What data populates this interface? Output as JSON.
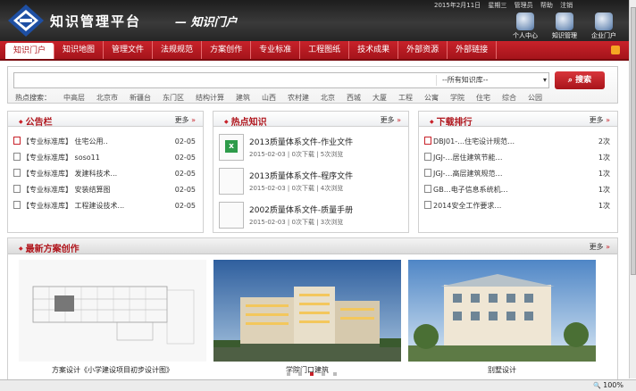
{
  "header": {
    "title": "知识管理平台",
    "subtitle": "— 知识门户",
    "topline": [
      "2015年2月11日",
      "星期三",
      "管理员",
      "帮助",
      "注销"
    ],
    "icons": [
      {
        "label": "个人中心",
        "icon": "person-icon"
      },
      {
        "label": "知识管理",
        "icon": "knowledge-icon"
      },
      {
        "label": "企业门户",
        "icon": "portal-icon"
      }
    ]
  },
  "nav": {
    "items": [
      "知识门户",
      "知识地图",
      "管理文件",
      "法规规范",
      "方案创作",
      "专业标准",
      "工程图纸",
      "技术成果",
      "外部资源",
      "外部链接"
    ]
  },
  "search": {
    "placeholder": "",
    "select_value": "--所有知识库--",
    "button": "搜索",
    "hot_label": "热点搜索：",
    "hot_words": [
      "中高层",
      "北京市",
      "新疆台",
      "东门区",
      "结构计算",
      "建筑",
      "山西",
      "农村建",
      "北京",
      "西城",
      "大厦",
      "工程",
      "公寓",
      "学院",
      "住宅",
      "综合",
      "公园"
    ]
  },
  "notice": {
    "title": "公告栏",
    "more": "更多",
    "rows": [
      {
        "text": "【专业标准库】 住宅公用..",
        "date": "02-05"
      },
      {
        "text": "【专业标准库】 soso11",
        "date": "02-05"
      },
      {
        "text": "【专业标准库】 发建科技术...",
        "date": "02-05"
      },
      {
        "text": "【专业标准库】 安装结算图",
        "date": "02-05"
      },
      {
        "text": "【专业标准库】 工程建设技术...",
        "date": "02-05"
      }
    ]
  },
  "hot": {
    "title": "热点知识",
    "more": "更多",
    "items": [
      {
        "title": "2013质量体系文件-作业文件",
        "meta": "2015-02-03 | 0次下载 | 5次浏览"
      },
      {
        "title": "2013质量体系文件-程序文件",
        "meta": "2015-02-03 | 0次下载 | 4次浏览"
      },
      {
        "title": "2002质量体系文件-质量手册",
        "meta": "2015-02-03 | 0次下载 | 3次浏览"
      }
    ]
  },
  "download": {
    "title": "下载排行",
    "more": "更多",
    "rows": [
      {
        "text": "DBJ01-…住宅设计规范…",
        "count": "2次"
      },
      {
        "text": "JGJ-…居住建筑节能…",
        "count": "1次"
      },
      {
        "text": "JGJ-…高层建筑规范…",
        "count": "1次"
      },
      {
        "text": "GB…电子信息系统机…",
        "count": "1次"
      },
      {
        "text": "2014安全工作要求…",
        "count": "1次"
      }
    ]
  },
  "gallery": {
    "title": "最新方案创作",
    "more": "更多",
    "items": [
      {
        "caption": "方案设计《小学建设项目初步设计图》"
      },
      {
        "caption": "学院门口建筑"
      },
      {
        "caption": "别墅设计"
      }
    ]
  },
  "status": {
    "zoom": "100%"
  }
}
